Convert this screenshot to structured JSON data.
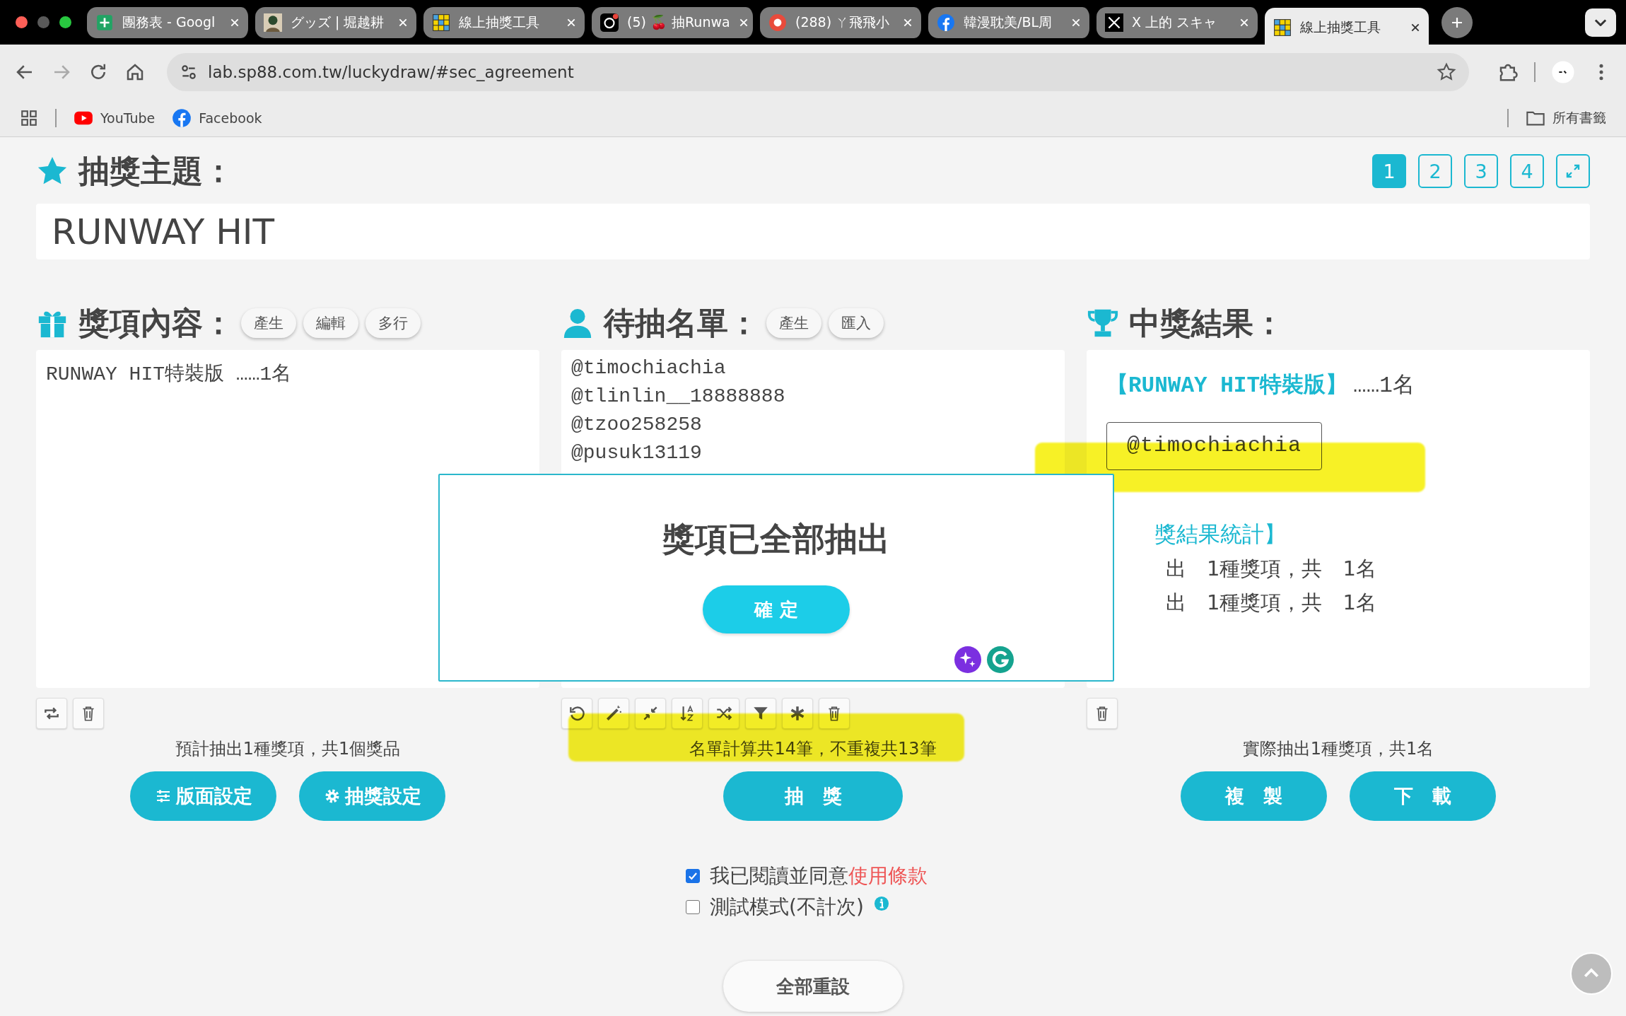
{
  "browser": {
    "tabs": [
      {
        "title": "團務表 - Googl",
        "kind": "sheets",
        "selected": false
      },
      {
        "title": "グッズ | 堀越耕",
        "kind": "avatar",
        "selected": false
      },
      {
        "title": "線上抽獎工具",
        "kind": "grid",
        "selected": false
      },
      {
        "title": "(5) 🍒 抽Runwa",
        "kind": "threads",
        "selected": false
      },
      {
        "title": "(288) ㄚ飛飛小",
        "kind": "round",
        "selected": false
      },
      {
        "title": "韓漫耽美/BL周",
        "kind": "facebook",
        "selected": false
      },
      {
        "title": "X 上的 スキャ",
        "kind": "x",
        "selected": false
      },
      {
        "title": "線上抽獎工具",
        "kind": "grid",
        "selected": true
      }
    ],
    "address": "lab.sp88.com.tw/luckydraw/#sec_agreement",
    "bookmarks": [
      {
        "label": "YouTube",
        "kind": "youtube"
      },
      {
        "label": "Facebook",
        "kind": "facebook"
      }
    ],
    "all_bookmarks": "所有書籤"
  },
  "topic": {
    "label": "抽獎主題：",
    "value": "RUNWAY HIT"
  },
  "pages": [
    {
      "label": "1",
      "selected": true
    },
    {
      "label": "2",
      "selected": false
    },
    {
      "label": "3",
      "selected": false
    },
    {
      "label": "4",
      "selected": false
    }
  ],
  "prizes": {
    "title": "獎項內容：",
    "actions": [
      "產生",
      "編輯",
      "多行"
    ],
    "text": "RUNWAY HIT特裝版 ……1名",
    "summary": "預計抽出1種獎項，共1個獎品",
    "buttons": [
      {
        "label": "版面設定",
        "kind": "sliders"
      },
      {
        "label": "抽獎設定",
        "kind": "gear"
      }
    ]
  },
  "entrants": {
    "title": "待抽名單：",
    "actions": [
      "產生",
      "匯入"
    ],
    "names": [
      "@timochiachia",
      "@tlinlin__18888888",
      "@tzoo258258",
      "@pusuk13119"
    ],
    "summary": "名單計算共14筆，不重複共13筆",
    "button": "抽　獎"
  },
  "results": {
    "title": "中獎結果：",
    "prize": "【RUNWAY HIT特裝版】",
    "prize_count": "……1名",
    "winner": "@timochiachia",
    "stats_title": "獎結果統計】",
    "stats": [
      "出　1種獎項，共　1名",
      "出　1種獎項，共　1名"
    ],
    "summary": "實際抽出1種獎項，共1名",
    "buttons": [
      "複　製",
      "下　載"
    ]
  },
  "agreement": [
    {
      "text": "我已閱讀並同意",
      "link": "使用條款",
      "checked": true
    },
    {
      "text": "測試模式(不計次)",
      "checked": false,
      "info": true
    }
  ],
  "reset": "全部重設",
  "dialog": {
    "message": "獎項已全部抽出",
    "button": "確 定"
  }
}
